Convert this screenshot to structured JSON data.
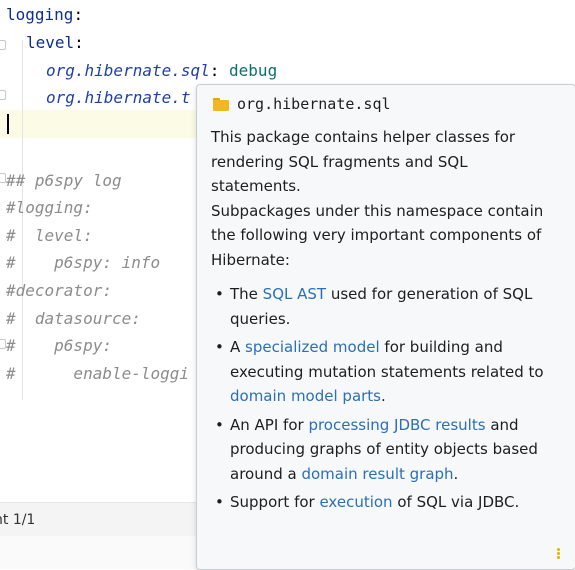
{
  "editor": {
    "lines": [
      {
        "key": "logging",
        "colon": ":"
      },
      {
        "key": "level",
        "colon": ":"
      },
      {
        "key": "org.hibernate.sql",
        "colon": ": ",
        "value": "debug"
      },
      {
        "key": "org.hibernate.t"
      },
      {
        "comment": "## p6spy log"
      },
      {
        "comment": "#logging:"
      },
      {
        "comment": "#  level:"
      },
      {
        "comment": "#    p6spy: info"
      },
      {
        "comment": "#decorator:"
      },
      {
        "comment": "#  datasource:"
      },
      {
        "comment": "#    p6spy:"
      },
      {
        "comment": "#      enable-loggi"
      }
    ]
  },
  "status": {
    "text": "nt 1/1"
  },
  "popup": {
    "title": "org.hibernate.sql",
    "para1": "This package contains helper classes for rendering SQL fragments and SQL statements.",
    "para2": "Subpackages under this namespace contain the following very important components of Hibernate:",
    "bullets": [
      {
        "pre": "The ",
        "link": "SQL AST",
        "post": " used for generation of SQL queries."
      },
      {
        "pre": "A ",
        "link": "specialized model",
        "mid": " for building and executing mutation statements related to ",
        "link2": "domain model parts",
        "post": "."
      },
      {
        "pre": "An API for ",
        "link": "processing JDBC results",
        "mid": " and producing graphs of entity objects based around a ",
        "link2": "domain result graph",
        "post": "."
      },
      {
        "pre": "Support for ",
        "link": "execution",
        "post": " of SQL via JDBC."
      }
    ]
  }
}
